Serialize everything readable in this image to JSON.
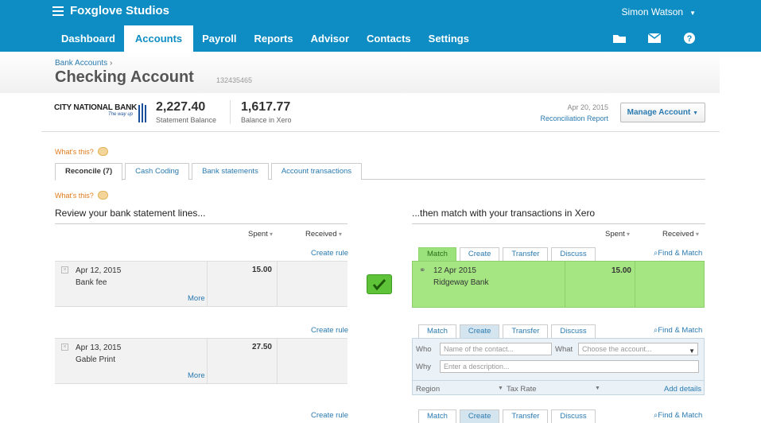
{
  "topbar": {
    "org_name": "Foxglove Studios",
    "user_name": "Simon Watson",
    "nav": [
      "Dashboard",
      "Accounts",
      "Payroll",
      "Reports",
      "Advisor",
      "Contacts",
      "Settings"
    ],
    "active_nav": "Accounts",
    "icons": [
      "folder-icon",
      "mail-icon",
      "help-icon"
    ]
  },
  "header": {
    "breadcrumb": "Bank Accounts",
    "breadcrumb_sep": "›",
    "title": "Checking Account",
    "account_number": "132435465"
  },
  "summary": {
    "bank_name": "CITY NATIONAL BANK",
    "bank_tagline": "The way up",
    "statement_balance": "2,227.40",
    "statement_balance_label": "Statement Balance",
    "xero_balance": "1,617.77",
    "xero_balance_label": "Balance in Xero",
    "statement_date": "Apr 20, 2015",
    "reconciliation_link": "Reconciliation Report",
    "manage_button": "Manage Account"
  },
  "whats_this": "What's this?",
  "tabs": [
    "Reconcile (7)",
    "Cash Coding",
    "Bank statements",
    "Account transactions"
  ],
  "left": {
    "title": "Review your bank statement lines...",
    "spent_header": "Spent",
    "received_header": "Received",
    "create_rule": "Create rule",
    "more": "More",
    "lines": [
      {
        "date": "Apr 12, 2015",
        "desc": "Bank fee",
        "spent": "15.00"
      },
      {
        "date": "Apr 13, 2015",
        "desc": "Gable Print",
        "spent": "27.50"
      }
    ]
  },
  "right": {
    "title": "...then match with your transactions in Xero",
    "spent_header": "Spent",
    "received_header": "Received",
    "match_tabs": [
      "Match",
      "Create",
      "Transfer",
      "Discuss"
    ],
    "find_match": "Find & Match",
    "matched": {
      "date": "12 Apr 2015",
      "desc": "Ridgeway Bank",
      "spent": "15.00"
    },
    "form": {
      "who_label": "Who",
      "who_placeholder": "Name of the contact...",
      "what_label": "What",
      "what_placeholder": "Choose the account...",
      "why_label": "Why",
      "why_placeholder": "Enter a description...",
      "region_label": "Region",
      "tax_label": "Tax Rate",
      "add_details": "Add details"
    }
  },
  "colors": {
    "brand": "#0e8dc4",
    "match_green": "#a5e683",
    "link": "#2a7ab0"
  }
}
